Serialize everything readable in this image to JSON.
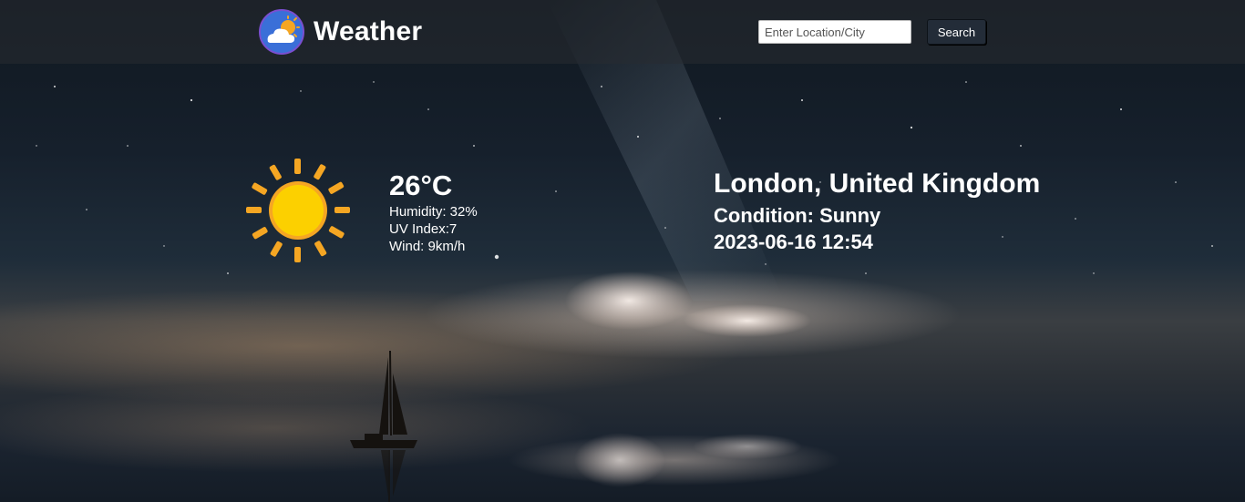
{
  "header": {
    "logo_icon": "cloud-sun-icon",
    "title": "Weather",
    "search": {
      "placeholder": "Enter Location/City",
      "value": ""
    },
    "search_button_label": "Search"
  },
  "current": {
    "icon": "sun-icon",
    "temperature": "26°C",
    "humidity": "Humidity: 32%",
    "uv_index": "UV Index:7",
    "wind": "Wind: 9km/h"
  },
  "location": {
    "name": "London, United Kingdom",
    "condition": "Condition: Sunny",
    "datetime": "2023-06-16 12:54"
  },
  "colors": {
    "header_bg": "#2c3036",
    "button_bg": "#232c38",
    "sun_rays": "#f5a623",
    "sun_core": "#fcd000"
  }
}
